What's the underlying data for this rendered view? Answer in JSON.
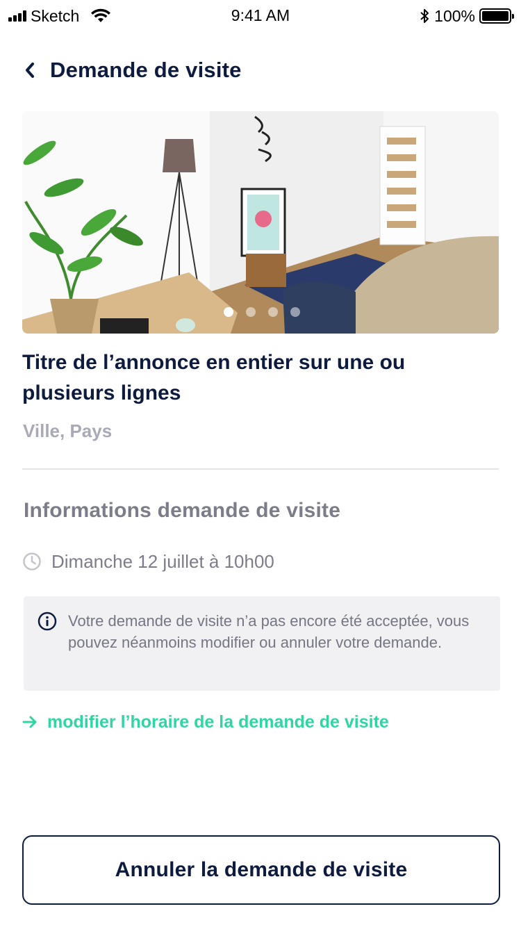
{
  "status_bar": {
    "carrier": "Sketch",
    "time": "9:41 AM",
    "battery": "100%"
  },
  "header": {
    "back_icon": "chevron-left-icon",
    "title": "Demande de visite"
  },
  "listing": {
    "gallery": {
      "slide_count": 4,
      "active_slide": 1
    },
    "title": "Titre de l’annonce en entier sur une ou plusieurs lignes",
    "location": "Ville, Pays"
  },
  "visit_info": {
    "section_title": "Informations demande de visite",
    "date_icon": "clock-icon",
    "date": "Dimanche 12 juillet à 10h00",
    "notice_icon": "info-icon",
    "notice": "Votre demande de visite n’a pas encore été acceptée, vous pouvez néanmoins modifier ou annuler votre demande."
  },
  "actions": {
    "modify_icon": "arrow-right-icon",
    "modify_label": "modifier l’horaire de la demande de visite",
    "cancel_label": "Annuler la demande de visite"
  },
  "colors": {
    "navy": "#0d1b3e",
    "gray_text": "#7c7c8a",
    "light_gray": "#a9a9b8",
    "info_bg": "#f1f1f3",
    "accent_green": "#2fd6a3"
  }
}
